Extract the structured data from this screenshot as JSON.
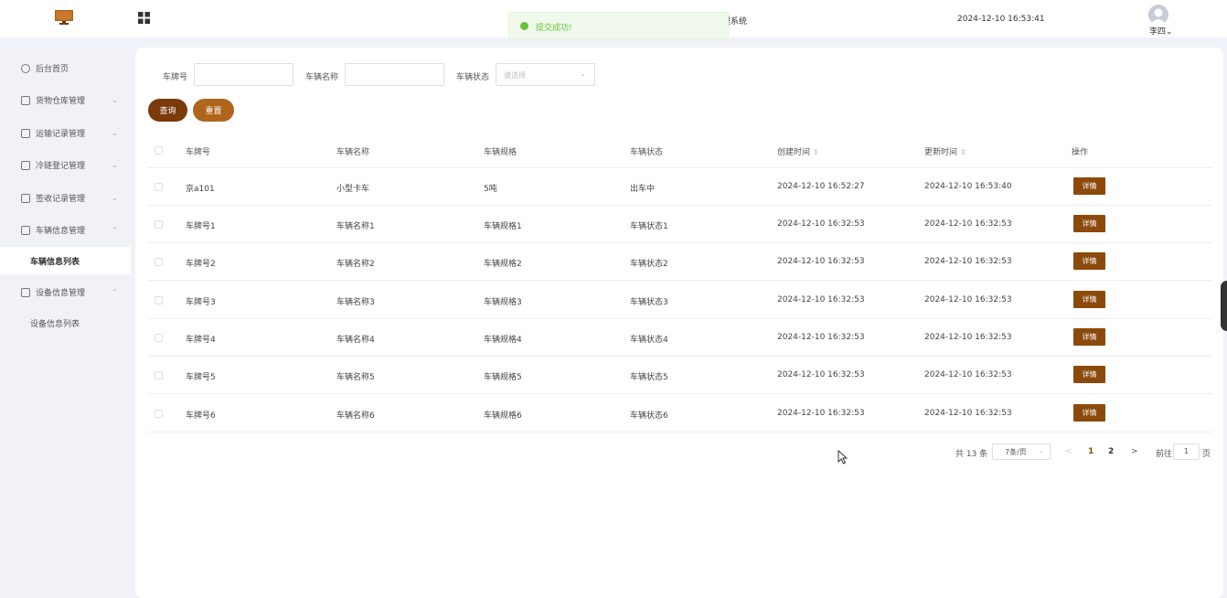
{
  "header": {
    "system_title": "理系统",
    "datetime": "2024-12-10 16:53:41",
    "user_name": "李四",
    "user_caret": "⌄"
  },
  "toast": {
    "message": "提交成功!"
  },
  "sidebar": {
    "items": [
      {
        "label": "后台首页",
        "icon": "clock-icon",
        "arrow": ""
      },
      {
        "label": "货物仓库管理",
        "icon": "folder-icon",
        "arrow": "⌄"
      },
      {
        "label": "运输记录管理",
        "icon": "folder-icon",
        "arrow": "⌄"
      },
      {
        "label": "冷链登记管理",
        "icon": "folder-icon",
        "arrow": "⌄"
      },
      {
        "label": "签收记录管理",
        "icon": "folder-icon",
        "arrow": "⌄"
      },
      {
        "label": "车辆信息管理",
        "icon": "folder-icon",
        "arrow": "⌃"
      },
      {
        "label": "车辆信息列表",
        "sub": true,
        "active": true
      },
      {
        "label": "设备信息管理",
        "icon": "folder-icon",
        "arrow": "⌃"
      },
      {
        "label": "设备信息列表",
        "sub": true,
        "active": false
      }
    ]
  },
  "filters": {
    "plate_label": "车牌号",
    "name_label": "车辆名称",
    "status_label": "车辆状态",
    "status_placeholder": "请选择",
    "query_button": "查询",
    "reset_button": "重置"
  },
  "table": {
    "columns": [
      "车牌号",
      "车辆名称",
      "车辆规格",
      "车辆状态",
      "创建时间",
      "更新时间",
      "操作"
    ],
    "sort_glyph": "⇕",
    "rows": [
      [
        "京a101",
        "小型卡车",
        "5吨",
        "出车中",
        "2024-12-10 16:52:27",
        "2024-12-10 16:53:40",
        "详情"
      ],
      [
        "车牌号1",
        "车辆名称1",
        "车辆规格1",
        "车辆状态1",
        "2024-12-10 16:32:53",
        "2024-12-10 16:32:53",
        "详情"
      ],
      [
        "车牌号2",
        "车辆名称2",
        "车辆规格2",
        "车辆状态2",
        "2024-12-10 16:32:53",
        "2024-12-10 16:32:53",
        "详情"
      ],
      [
        "车牌号3",
        "车辆名称3",
        "车辆规格3",
        "车辆状态3",
        "2024-12-10 16:32:53",
        "2024-12-10 16:32:53",
        "详情"
      ],
      [
        "车牌号4",
        "车辆名称4",
        "车辆规格4",
        "车辆状态4",
        "2024-12-10 16:32:53",
        "2024-12-10 16:32:53",
        "详情"
      ],
      [
        "车牌号5",
        "车辆名称5",
        "车辆规格5",
        "车辆状态5",
        "2024-12-10 16:32:53",
        "2024-12-10 16:32:53",
        "详情"
      ],
      [
        "车牌号6",
        "车辆名称6",
        "车辆规格6",
        "车辆状态6",
        "2024-12-10 16:32:53",
        "2024-12-10 16:32:53",
        "详情"
      ]
    ]
  },
  "pagination": {
    "total": "共 13 条",
    "page_size": "7条/页",
    "prev": "<",
    "pages": [
      "1",
      "2"
    ],
    "current": "1",
    "next": ">",
    "goto_label": "前往",
    "goto_value": "1",
    "page_unit": "页"
  },
  "colors": {
    "brand_dark": "#7a3a0a",
    "brand_light": "#b0651c",
    "detail_button": "#8b4a0c",
    "success": "#67c23a"
  }
}
